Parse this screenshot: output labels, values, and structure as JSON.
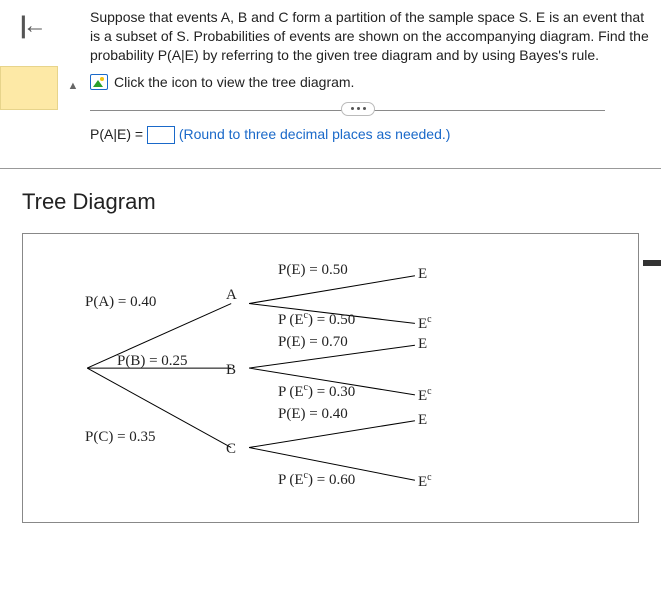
{
  "question": {
    "description": "Suppose that events A, B and C form a partition of the sample space S. E is an event that is a subset of S. Probabilities of events are shown on the accompanying diagram. Find the probability P(A|E) by referring to the given tree diagram and by using Bayes's rule.",
    "icon_prompt": "Click the icon to view the tree diagram.",
    "answer_label_pre": "P(A|E) = ",
    "answer_hint": "(Round to three decimal places as needed.)"
  },
  "tree": {
    "title": "Tree Diagram",
    "pa_lbl": "P(A) = 0.40",
    "pb_lbl": "P(B) = 0.25",
    "pc_lbl": "P(C) = 0.35",
    "a_lbl": "A",
    "b_lbl": "B",
    "c_lbl": "C",
    "e_lbl": "E",
    "ec_prefix": "E",
    "a_pe": "P(E) = 0.50",
    "a_pec_pre": "P",
    "a_pec_mid": "(E",
    "a_pec_post": ") = 0.50",
    "b_pe": "P(E) = 0.70",
    "b_pec_pre": "P",
    "b_pec_mid": "(E",
    "b_pec_post": ") = 0.30",
    "c_pe": "P(E) = 0.40",
    "c_pec_pre": "P",
    "c_pec_mid": "(E",
    "c_pec_post": ") = 0.60"
  },
  "chart_data": {
    "type": "table",
    "title": "Tree Diagram",
    "partitions": [
      {
        "name": "A",
        "prior": 0.4,
        "p_e": 0.5,
        "p_ec": 0.5
      },
      {
        "name": "B",
        "prior": 0.25,
        "p_e": 0.7,
        "p_ec": 0.3
      },
      {
        "name": "C",
        "prior": 0.35,
        "p_e": 0.4,
        "p_ec": 0.6
      }
    ]
  }
}
